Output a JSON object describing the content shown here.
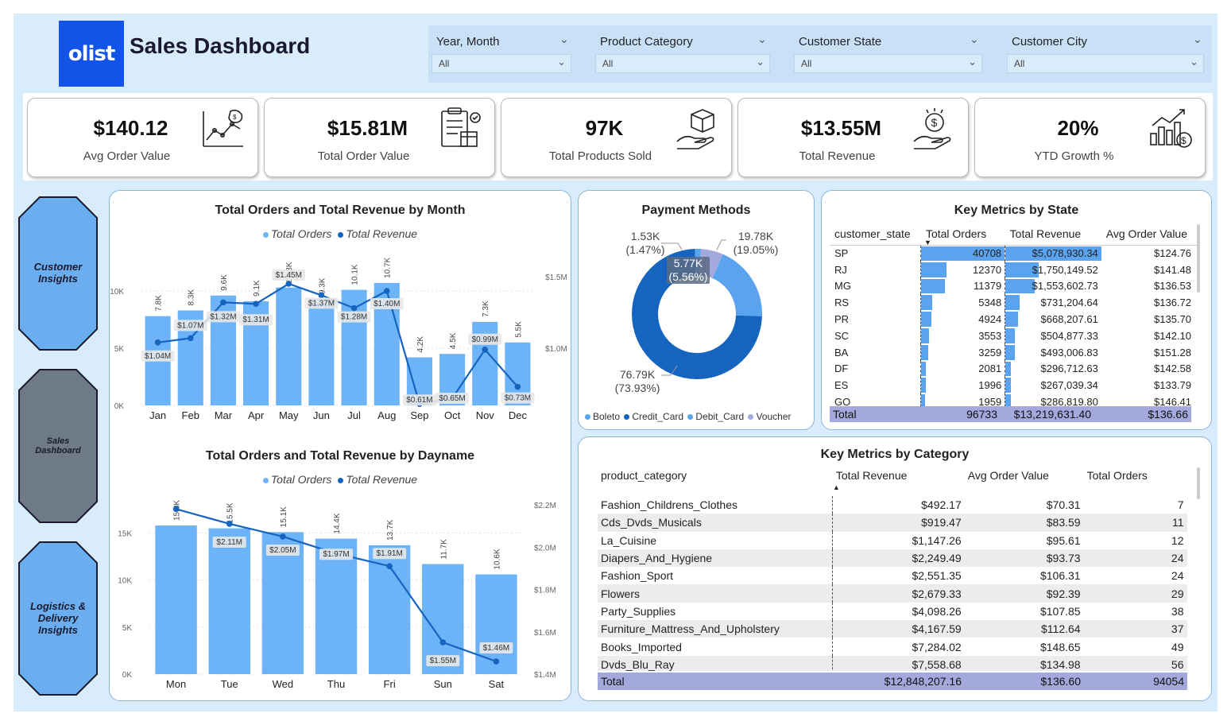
{
  "header": {
    "logo_text": "olist",
    "title": "Sales Dashboard"
  },
  "filters": [
    {
      "label": "Year, Month",
      "value": "All"
    },
    {
      "label": "Product Category",
      "value": "All"
    },
    {
      "label": "Customer State",
      "value": "All"
    },
    {
      "label": "Customer City",
      "value": "All"
    }
  ],
  "kpis": [
    {
      "value": "$140.12",
      "label": "Avg Order Value",
      "icon": "chart-money-icon"
    },
    {
      "value": "$15.81M",
      "label": "Total Order Value",
      "icon": "clipboard-box-icon"
    },
    {
      "value": "97K",
      "label": "Total Products Sold",
      "icon": "hand-box-icon"
    },
    {
      "value": "$13.55M",
      "label": "Total Revenue",
      "icon": "hand-dollar-icon"
    },
    {
      "value": "20%",
      "label": "YTD Growth %",
      "icon": "growth-chart-icon"
    }
  ],
  "nav": [
    {
      "label": "Customer Insights",
      "color": "#6aaef0"
    },
    {
      "label": "Sales Dashboard",
      "color": "#6e7a85"
    },
    {
      "label": "Logistics & Delivery Insights",
      "color": "#6aaef0"
    }
  ],
  "colors": {
    "bar": "#6cb4f7",
    "line": "#1565c0",
    "boleto": "#5aa3ee",
    "credit": "#1565c0",
    "debit": "#5aa3ee",
    "voucher": "#a3a9dd"
  },
  "chart_data": [
    {
      "type": "bar",
      "title": "Total Orders and Total Revenue by Month",
      "legend": [
        "Total Orders",
        "Total Revenue"
      ],
      "categories": [
        "Jan",
        "Feb",
        "Mar",
        "Apr",
        "May",
        "Jun",
        "Jul",
        "Aug",
        "Sep",
        "Oct",
        "Nov",
        "Dec"
      ],
      "series": [
        {
          "name": "Total Orders",
          "values": [
            7800,
            8300,
            9600,
            9100,
            10300,
            9300,
            10100,
            10700,
            4200,
            4500,
            7300,
            5500
          ],
          "labels": [
            "7.8K",
            "8.3K",
            "9.6K",
            "9.1K",
            "10.3K",
            "9.3K",
            "10.1K",
            "10.7K",
            "4.2K",
            "4.5K",
            "7.3K",
            "5.5K"
          ]
        },
        {
          "name": "Total Revenue",
          "values": [
            1.04,
            1.07,
            1.32,
            1.31,
            1.45,
            1.37,
            1.28,
            1.4,
            0.61,
            0.65,
            0.99,
            0.73
          ],
          "labels": [
            "$1.04M",
            "$1.07M",
            "$1.32M",
            "$1.31M",
            "$1.45M",
            "$1.37M",
            "$1.28M",
            "$1.40M",
            "$0.61M",
            "$0.65M",
            "$0.99M",
            "$0.73M"
          ]
        }
      ],
      "yticks_left": [
        "0K",
        "5K",
        "10K"
      ],
      "yticks_right": [
        "$1.0M",
        "$1.5M"
      ],
      "ylim_left": [
        0,
        12500
      ],
      "ylim_right": [
        0.6,
        1.6
      ]
    },
    {
      "type": "bar",
      "title": "Total Orders and Total Revenue by Dayname",
      "legend": [
        "Total Orders",
        "Total Revenue"
      ],
      "categories": [
        "Mon",
        "Tue",
        "Wed",
        "Thu",
        "Fri",
        "Sun",
        "Sat"
      ],
      "series": [
        {
          "name": "Total Orders",
          "values": [
            15800,
            15500,
            15100,
            14400,
            13700,
            11700,
            10600
          ],
          "labels": [
            "15.8K",
            "15.5K",
            "15.1K",
            "14.4K",
            "13.7K",
            "11.7K",
            "10.6K"
          ]
        },
        {
          "name": "Total Revenue",
          "values": [
            2.18,
            2.11,
            2.05,
            1.97,
            1.91,
            1.55,
            1.46
          ],
          "labels": [
            "",
            "$2.11M",
            "$2.05M",
            "$1.97M",
            "$1.91M",
            "$1.55M",
            "$1.46M"
          ]
        }
      ],
      "yticks_left": [
        "0K",
        "5K",
        "10K",
        "15K"
      ],
      "yticks_right": [
        "$1.4M",
        "$1.6M",
        "$1.8M",
        "$2.0M",
        "$2.2M"
      ],
      "ylim_left": [
        0,
        18000
      ],
      "ylim_right": [
        1.4,
        2.2
      ]
    },
    {
      "type": "pie",
      "title": "Payment Methods",
      "slices": [
        {
          "name": "Boleto",
          "value": 19.05,
          "label": "19.78K\n(19.05%)"
        },
        {
          "name": "Credit_Card",
          "value": 73.93,
          "label": "76.79K\n(73.93%)"
        },
        {
          "name": "Debit_Card",
          "value": 1.47,
          "label": "1.53K\n(1.47%)"
        },
        {
          "name": "Voucher",
          "value": 5.56,
          "label": "5.77K\n(5.56%)"
        }
      ]
    }
  ],
  "state_table": {
    "title": "Key Metrics by State",
    "columns": [
      "customer_state",
      "Total Orders",
      "Total Revenue",
      "Avg Order Value"
    ],
    "rows": [
      [
        "SP",
        "40708",
        "$5,078,930.34",
        "$124.76"
      ],
      [
        "RJ",
        "12370",
        "$1,750,149.52",
        "$141.48"
      ],
      [
        "MG",
        "11379",
        "$1,553,602.73",
        "$136.53"
      ],
      [
        "RS",
        "5348",
        "$731,204.64",
        "$136.72"
      ],
      [
        "PR",
        "4924",
        "$668,207.61",
        "$135.70"
      ],
      [
        "SC",
        "3553",
        "$504,877.33",
        "$142.10"
      ],
      [
        "BA",
        "3259",
        "$493,006.83",
        "$151.28"
      ],
      [
        "DF",
        "2081",
        "$296,712.63",
        "$142.58"
      ],
      [
        "ES",
        "1996",
        "$267,039.34",
        "$133.79"
      ],
      [
        "GO",
        "1959",
        "$286,819.80",
        "$146.41"
      ]
    ],
    "orders_bar": [
      40708,
      12370,
      11379,
      5348,
      4924,
      3553,
      3259,
      2081,
      1996,
      1959
    ],
    "revenue_bar": [
      5078930.34,
      1750149.52,
      1553602.73,
      731204.64,
      668207.61,
      504877.33,
      493006.83,
      296712.63,
      267039.34,
      286819.8
    ],
    "total": [
      "Total",
      "96733",
      "$13,219,631.40",
      "$136.66"
    ]
  },
  "category_table": {
    "title": "Key Metrics by Category",
    "columns": [
      "product_category",
      "Total Revenue",
      "Avg Order Value",
      "Total Orders"
    ],
    "rows": [
      [
        "Fashion_Childrens_Clothes",
        "$492.17",
        "$70.31",
        "7"
      ],
      [
        "Cds_Dvds_Musicals",
        "$919.47",
        "$83.59",
        "11"
      ],
      [
        "La_Cuisine",
        "$1,147.26",
        "$95.61",
        "12"
      ],
      [
        "Diapers_And_Hygiene",
        "$2,249.49",
        "$93.73",
        "24"
      ],
      [
        "Fashion_Sport",
        "$2,551.35",
        "$106.31",
        "24"
      ],
      [
        "Flowers",
        "$2,679.33",
        "$92.39",
        "29"
      ],
      [
        "Party_Supplies",
        "$4,098.26",
        "$107.85",
        "38"
      ],
      [
        "Furniture_Mattress_And_Upholstery",
        "$4,167.59",
        "$112.64",
        "37"
      ],
      [
        "Books_Imported",
        "$7,284.02",
        "$148.65",
        "49"
      ],
      [
        "Dvds_Blu_Ray",
        "$7,558.68",
        "$134.98",
        "56"
      ]
    ],
    "total": [
      "Total",
      "$12,848,207.16",
      "$136.60",
      "94054"
    ]
  }
}
